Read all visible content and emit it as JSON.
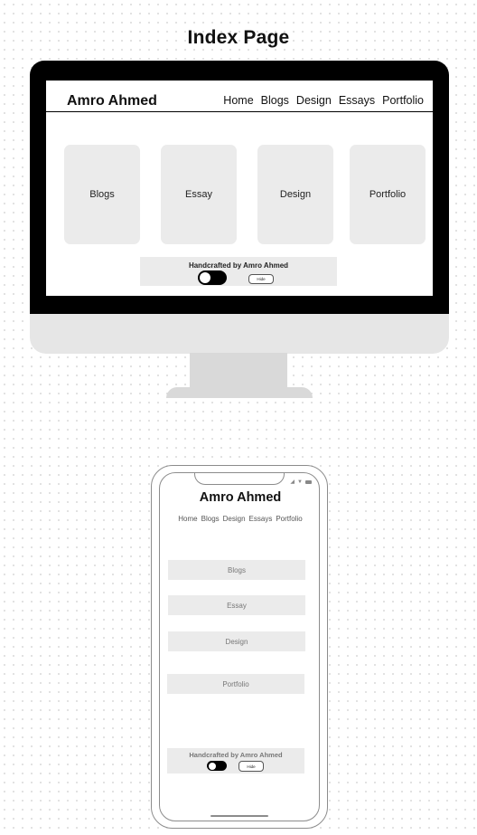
{
  "page_title": "Index Page",
  "desktop": {
    "brand": "Amro Ahmed",
    "nav": [
      "Home",
      "Blogs",
      "Design",
      "Essays",
      "Portfolio"
    ],
    "cards": [
      "Blogs",
      "Essay",
      "Design",
      "Portfolio"
    ],
    "footer_text": "Handcrafted by Amro Ahmed",
    "hide_button": "Hide"
  },
  "mobile": {
    "brand": "Amro Ahmed",
    "nav": [
      "Home",
      "Blogs",
      "Design",
      "Essays",
      "Portfolio"
    ],
    "rows": [
      "Blogs",
      "Essay",
      "Design",
      "Portfolio"
    ],
    "footer_text": "Handcrafted by Amro Ahmed",
    "hide_button": "Hide"
  }
}
